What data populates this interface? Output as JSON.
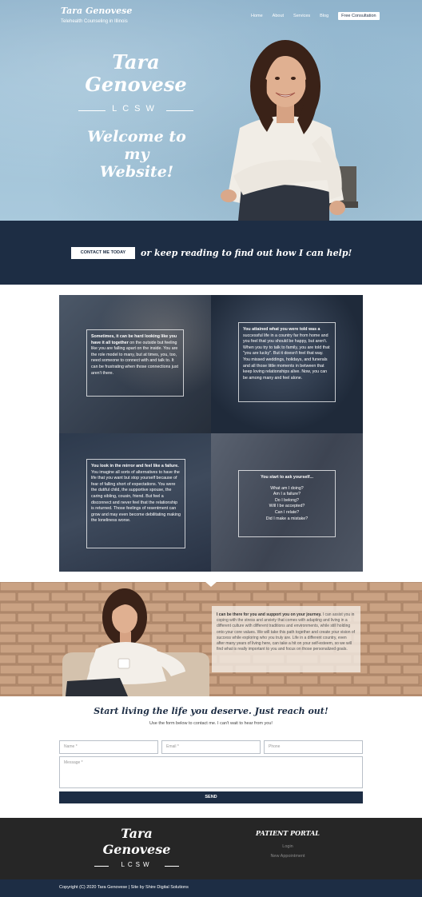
{
  "header": {
    "brand_name": "Tara Genovese",
    "brand_tagline": "Telehealth Counseling in Illinois",
    "nav": [
      "Home",
      "About",
      "Services",
      "Blog"
    ],
    "nav_cta": "Free Consultation"
  },
  "hero": {
    "name_line1": "Tara",
    "name_line2": "Genovese",
    "credential": "LCSW",
    "welcome_line1": "Welcome to my",
    "welcome_line2": "Website!"
  },
  "cta_band": {
    "button": "CONTACT ME TODAY",
    "text": "or keep reading to find out how I can help!"
  },
  "grid": {
    "cell1": {
      "lead": "Sometimes, it can be hard looking like you have it all together",
      "body": " on the outside but feeling like you are falling apart on the inside. You are the role model to many, but at times, you, too, need someone to connect with and talk to. It can be frustrating when those connections just aren't there."
    },
    "cell2": {
      "lead": "You attained what you were told was a",
      "body": " successful life in a country far from home and you feel that you should be happy, but aren't. When you try to talk to family, you are told that \"you are lucky\". But it doesn't feel that way. You missed weddings, holidays, and funerals and all those little moments in between that keep loving relationships alive. Now, you can be among many and feel alone."
    },
    "cell3": {
      "lead": "You look in the mirror and feel like a failure.",
      "body": " You imagine all sorts of alternatives to have the life that you want but stop yourself because of fear of falling short of expectations. You were the dutiful child, the supportive spouse, the caring sibling, cousin, friend. But feel a disconnect and never feel that the relationship is returned. Those feelings of resentment can grow and may even become debilitating making the loneliness worse."
    },
    "cell4": {
      "lead": "You start to ask yourself...",
      "questions": [
        "What am I doing?",
        "Am I a failure?",
        "Do I belong?",
        "Will I be accepted?",
        "Can I relate?",
        "Did I make a mistake?"
      ]
    }
  },
  "support": {
    "lead": "I can be there for you and support you on your journey.",
    "body": " I can assist you in coping with the stress and anxiety that comes with adapting and living in a different culture with different traditions and environments, while still holding onto your core values. We will take this path together and create your vision of success while exploring who you truly are. Life in a different country, even after many years of living here, can take a hit on your self-esteem, so we will find what is really important to you and focus on those personalized goals."
  },
  "contact": {
    "title": "Start living the life you deserve. Just reach out!",
    "subtitle": "Use the form below to contact me. I can't wait to hear from you!",
    "name_placeholder": "Name *",
    "email_placeholder": "Email *",
    "phone_placeholder": "Phone",
    "message_placeholder": "Message *",
    "send": "SEND"
  },
  "footer": {
    "name_line1": "Tara",
    "name_line2": "Genovese",
    "credential": "LCSW",
    "portal_title": "PATIENT PORTAL",
    "portal_links": [
      "Login",
      "New Appointment"
    ],
    "copyright": "Copyright (C) 2020 Tara Genovese | Site by Shire Digital Solutions"
  },
  "colors": {
    "navy": "#1d2d44",
    "footer_dark": "#262626",
    "hero_blue": "#9ec1d7",
    "brick": "#c39a7a"
  }
}
